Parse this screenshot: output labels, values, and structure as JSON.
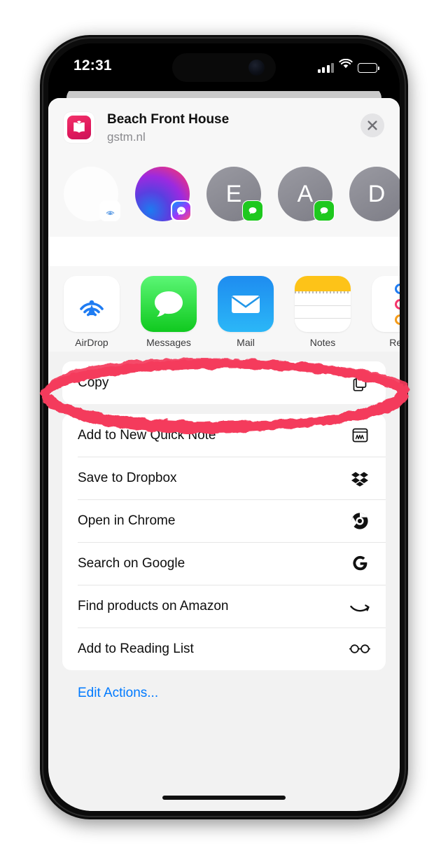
{
  "status_bar": {
    "time": "12:31",
    "signal_icon": "cellular-bars-icon",
    "wifi_icon": "wifi-icon",
    "battery_icon": "battery-icon",
    "battery_level_pct": 70
  },
  "share_sheet": {
    "header": {
      "app_icon": "apple-books-icon",
      "title": "Beach Front House",
      "subtitle": "gstm.nl",
      "close_icon": "close-icon"
    },
    "contacts": [
      {
        "name": "",
        "type": "blank",
        "badge": "airdrop-badge-icon"
      },
      {
        "name": "",
        "type": "gradient",
        "badge": "messenger-badge-icon"
      },
      {
        "name": "",
        "initial": "E",
        "type": "initial",
        "badge": "messages-badge-icon"
      },
      {
        "name": "",
        "initial": "A",
        "type": "initial",
        "badge": "messages-badge-icon"
      },
      {
        "name": "",
        "initial": "D",
        "type": "initial",
        "badge": "messages-badge-icon"
      }
    ],
    "apps": [
      {
        "label": "AirDrop",
        "icon": "airdrop-icon"
      },
      {
        "label": "Messages",
        "icon": "messages-icon"
      },
      {
        "label": "Mail",
        "icon": "mail-icon"
      },
      {
        "label": "Notes",
        "icon": "notes-icon"
      },
      {
        "label": "Rem",
        "icon": "reminders-icon"
      }
    ],
    "primary_action": {
      "label": "Copy",
      "icon": "copy-documents-icon"
    },
    "actions": [
      {
        "label": "Add to New Quick Note",
        "icon": "quick-note-icon"
      },
      {
        "label": "Save to Dropbox",
        "icon": "dropbox-icon"
      },
      {
        "label": "Open in Chrome",
        "icon": "chrome-icon"
      },
      {
        "label": "Search on Google",
        "icon": "google-g-icon"
      },
      {
        "label": "Find products on Amazon",
        "icon": "amazon-smile-icon"
      },
      {
        "label": "Add to Reading List",
        "icon": "reading-glasses-icon"
      }
    ],
    "edit_actions_label": "Edit Actions..."
  },
  "annotation": {
    "shape": "hand-drawn-ellipse",
    "color": "#F43B5C",
    "targets": "Copy"
  },
  "colors": {
    "accent_blue": "#007AFF",
    "sheet_bg": "#F2F2F2",
    "card_bg": "#FFFFFF",
    "annotation_red": "#F43B5C"
  }
}
